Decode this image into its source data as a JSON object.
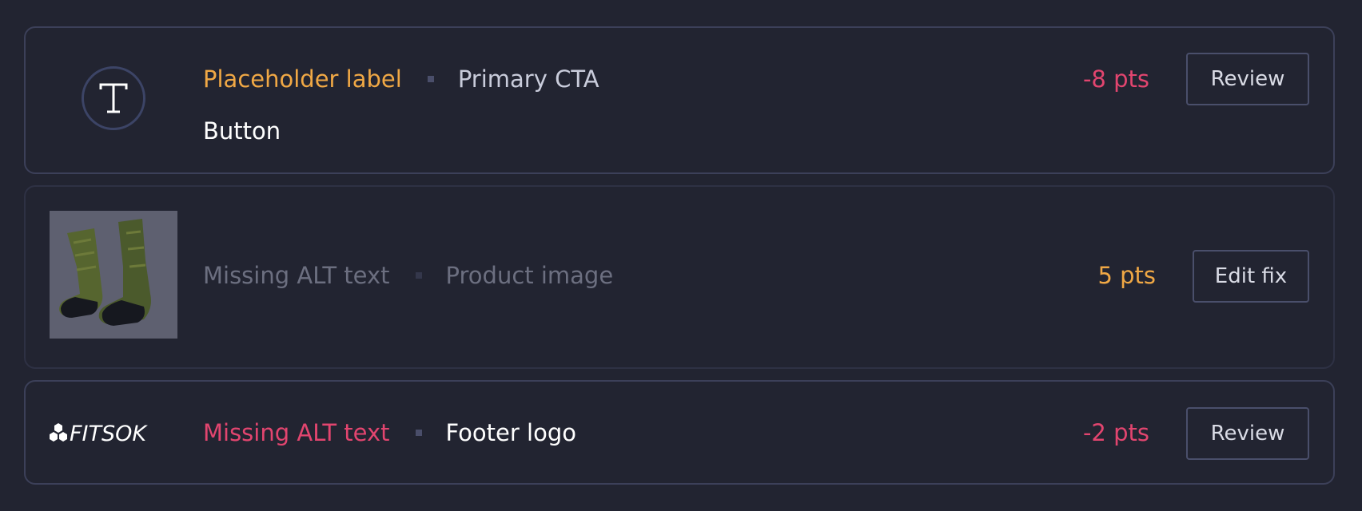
{
  "items": [
    {
      "icon": "text-type-icon",
      "tag": "Placeholder label",
      "target": "Primary CTA",
      "sub": "Button",
      "points": "-8 pts",
      "action": "Review",
      "colors": {
        "tag": "#f0a845",
        "target": "#c9ccdb",
        "points": "#e2456f"
      }
    },
    {
      "icon": "product-image-thumbnail",
      "tag": "Missing ALT text",
      "target": "Product image",
      "points": "5 pts",
      "action": "Edit fix",
      "colors": {
        "tag": "#6c6f80",
        "target": "#6c6f80",
        "points": "#f0a845"
      }
    },
    {
      "icon": "brand-logo",
      "logo_text": "FITSOK",
      "tag": "Missing ALT text",
      "target": "Footer logo",
      "points": "-2 pts",
      "action": "Review",
      "colors": {
        "tag": "#e2456f",
        "target": "#ffffff",
        "points": "#e2456f"
      }
    }
  ]
}
